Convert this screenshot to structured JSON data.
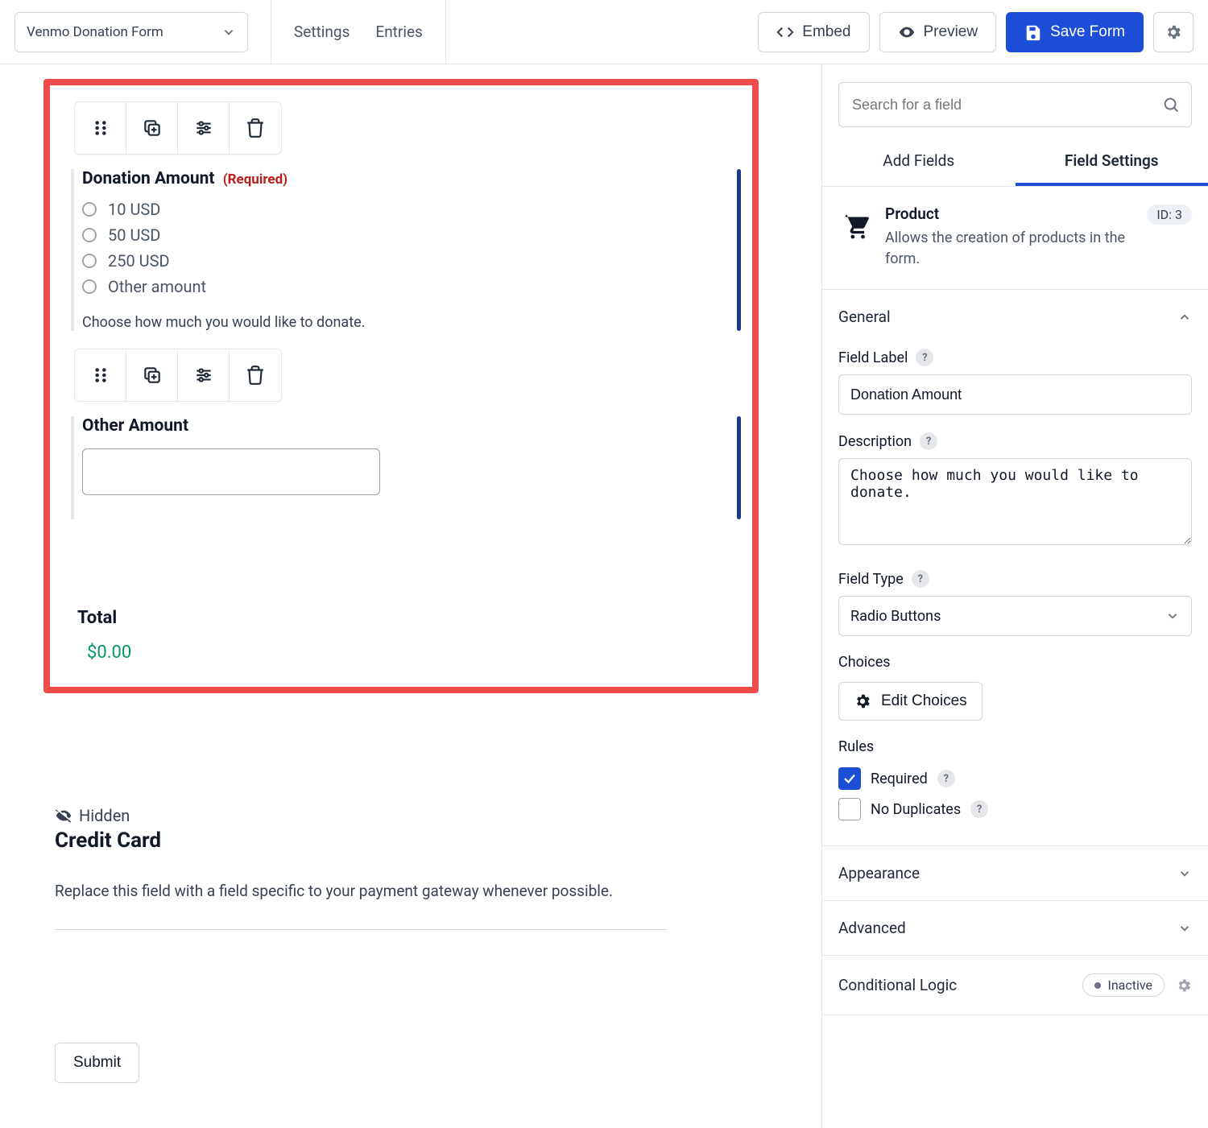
{
  "header": {
    "form_name": "Venmo Donation Form",
    "nav": {
      "settings": "Settings",
      "entries": "Entries"
    },
    "buttons": {
      "embed": "Embed",
      "preview": "Preview",
      "save": "Save Form"
    }
  },
  "canvas": {
    "fields": {
      "donation": {
        "label": "Donation Amount",
        "required_badge": "(Required)",
        "options": [
          "10 USD",
          "50 USD",
          "250 USD",
          "Other amount"
        ],
        "help": "Choose how much you would like to donate."
      },
      "other": {
        "label": "Other Amount",
        "value": ""
      },
      "total": {
        "label": "Total",
        "value": "$0.00"
      }
    },
    "cc": {
      "hidden_label": "Hidden",
      "title": "Credit Card",
      "note": "Replace this field with a field specific to your payment gateway whenever possible."
    },
    "submit": "Submit"
  },
  "sidebar": {
    "search_placeholder": "Search for a field",
    "tabs": {
      "add": "Add Fields",
      "settings": "Field Settings"
    },
    "type": {
      "name": "Product",
      "desc": "Allows the creation of products in the form.",
      "id_badge": "ID: 3"
    },
    "sections": {
      "general": "General",
      "appearance": "Appearance",
      "advanced": "Advanced",
      "conditional": "Conditional Logic"
    },
    "general": {
      "field_label_lbl": "Field Label",
      "field_label_val": "Donation Amount",
      "description_lbl": "Description",
      "description_val": "Choose how much you would like to donate.",
      "field_type_lbl": "Field Type",
      "field_type_val": "Radio Buttons",
      "choices_lbl": "Choices",
      "edit_choices": "Edit Choices",
      "rules_lbl": "Rules",
      "required_lbl": "Required",
      "no_dup_lbl": "No Duplicates"
    },
    "conditional_status": "Inactive"
  }
}
